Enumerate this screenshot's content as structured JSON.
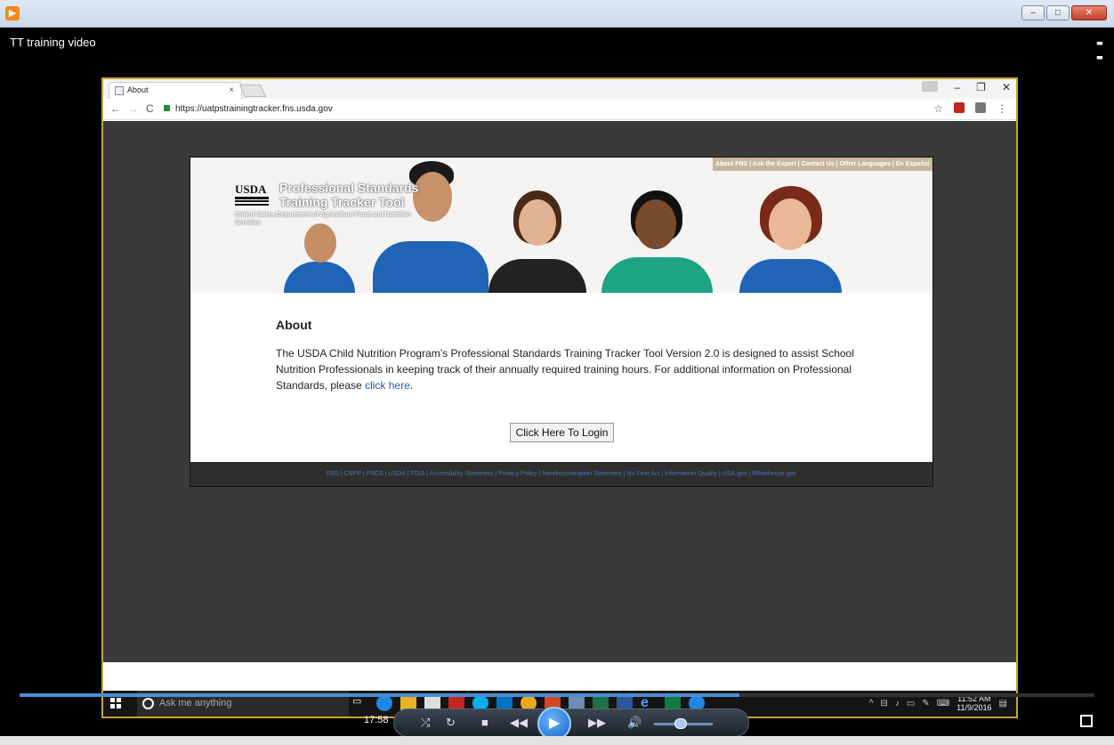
{
  "player": {
    "title": "TT training video",
    "time": "17:58",
    "progress": 0.67,
    "volume": 0.45
  },
  "browser": {
    "tab_title": "About",
    "tab_close": "×",
    "url": "https://uatpstrainingtracker.fns.usda.gov"
  },
  "site": {
    "top_links": "About FNS | Ask the Expert | Contact Us | Other Languages | En Español",
    "usda": "USDA",
    "title": "Professional Standards Training Tracker Tool",
    "subtitle": "United States Department of Agriculture Food and Nutrition Services",
    "about_heading": "About",
    "about_text": "The USDA Child Nutrition Program’s Professional Standards Training Tracker Tool Version 2.0 is designed to assist School Nutrition Professionals in keeping track of their annually required training hours. For additional information on Professional Standards, please ",
    "about_link": "click here",
    "about_end": ".",
    "login_button": "Click Here To Login",
    "footer": "FNS  |  CNPP  |  FNCS  |  USDA  |  FOIA  |  Accessibility Statement  |  Privacy Policy  |  Nondiscrimination Statement  |  No Fear Act  |  Information Quality  |  USA.gov  |  Whitehouse.gov"
  },
  "taskbar": {
    "search_placeholder": "Ask me anything",
    "clock_time": "11:52 AM",
    "clock_date": "11/9/2016"
  },
  "colors": {
    "accent": "#c8a431",
    "link": "#1f5aa8",
    "footer_bg": "#2e2e2e",
    "progress": "#4a8fd8"
  }
}
